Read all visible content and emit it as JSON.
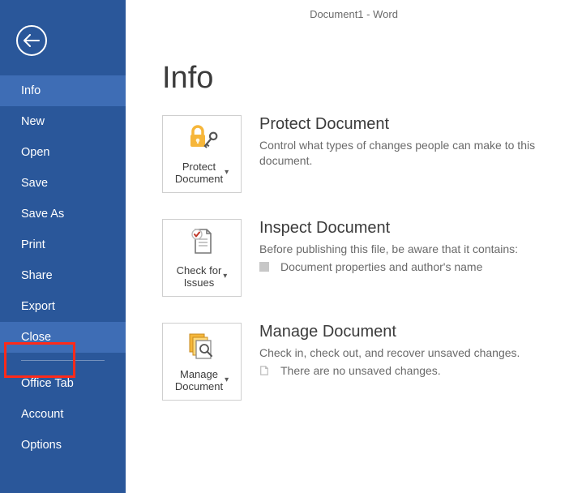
{
  "window_title": "Document1 - Word",
  "page_heading": "Info",
  "sidebar": {
    "items": [
      {
        "label": "Info",
        "selected": true
      },
      {
        "label": "New"
      },
      {
        "label": "Open"
      },
      {
        "label": "Save"
      },
      {
        "label": "Save As"
      },
      {
        "label": "Print"
      },
      {
        "label": "Share"
      },
      {
        "label": "Export"
      },
      {
        "label": "Close",
        "highlighted": true
      }
    ],
    "footer_items": [
      {
        "label": "Office Tab"
      },
      {
        "label": "Account"
      },
      {
        "label": "Options"
      }
    ]
  },
  "sections": {
    "protect": {
      "tile_label": "Protect\nDocument",
      "heading": "Protect Document",
      "desc": "Control what types of changes people can make to this document."
    },
    "inspect": {
      "tile_label": "Check for\nIssues",
      "heading": "Inspect Document",
      "desc": "Before publishing this file, be aware that it contains:",
      "bullet": "Document properties and author's name"
    },
    "manage": {
      "tile_label": "Manage\nDocument",
      "heading": "Manage Document",
      "desc": "Check in, check out, and recover unsaved changes.",
      "bullet": "There are no unsaved changes."
    }
  }
}
